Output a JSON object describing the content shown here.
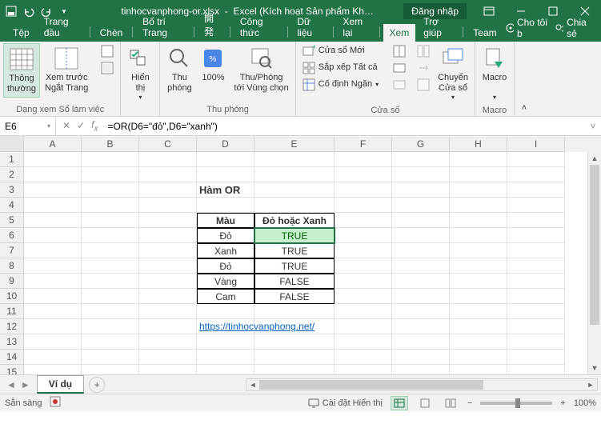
{
  "titlebar": {
    "filename": "tinhocvanphong-or.xlsx",
    "app": "Excel (Kích hoạt Sản phẩm Kh…",
    "signin": "Đăng nhập"
  },
  "menu": {
    "tabs": [
      "Tệp",
      "Trang đầu",
      "Chèn",
      "Bố trí Trang",
      "開発",
      "Công thức",
      "Dữ liệu",
      "Xem lại",
      "Xem",
      "Trợ giúp",
      "Team"
    ],
    "active": 8,
    "tellme": "Cho tôi b",
    "share": "Chia sẻ"
  },
  "ribbon": {
    "group1_label": "Dạng xem Sổ làm việc",
    "btn_normal": "Thông\nthường",
    "btn_pagebreak": "Xem trước\nNgắt Trang",
    "btn_show": "Hiển\nthị",
    "group2_label": "Thu phóng",
    "btn_zoom": "Thu\nphóng",
    "btn_100": "100%",
    "btn_zoomsel": "Thu/Phóng\ntới Vùng chọn",
    "group3_label": "Cửa sổ",
    "btn_newwin": "Cửa sổ Mới",
    "btn_arrange": "Sắp xếp Tất cả",
    "btn_freeze": "Cố định Ngăn",
    "btn_switch": "Chuyển\nCửa sổ",
    "group4_label": "Macro",
    "btn_macro": "Macro"
  },
  "formula": {
    "cell": "E6",
    "value": "=OR(D6=\"đỏ\",D6=\"xanh\")"
  },
  "grid": {
    "cols": [
      "A",
      "B",
      "C",
      "D",
      "E",
      "F",
      "G",
      "H",
      "I"
    ],
    "title": "Hàm OR",
    "headers": [
      "Màu",
      "Đỏ hoặc Xanh"
    ],
    "rows": [
      [
        "Đỏ",
        "TRUE"
      ],
      [
        "Xanh",
        "TRUE"
      ],
      [
        "Đỏ",
        "TRUE"
      ],
      [
        "Vàng",
        "FALSE"
      ],
      [
        "Cam",
        "FALSE"
      ]
    ],
    "link": "https://tinhocvanphong.net/"
  },
  "sheet": {
    "tab": "Ví dụ"
  },
  "status": {
    "ready": "Sẵn sàng",
    "display": "Cài đặt Hiển thị",
    "zoom": "100%"
  }
}
